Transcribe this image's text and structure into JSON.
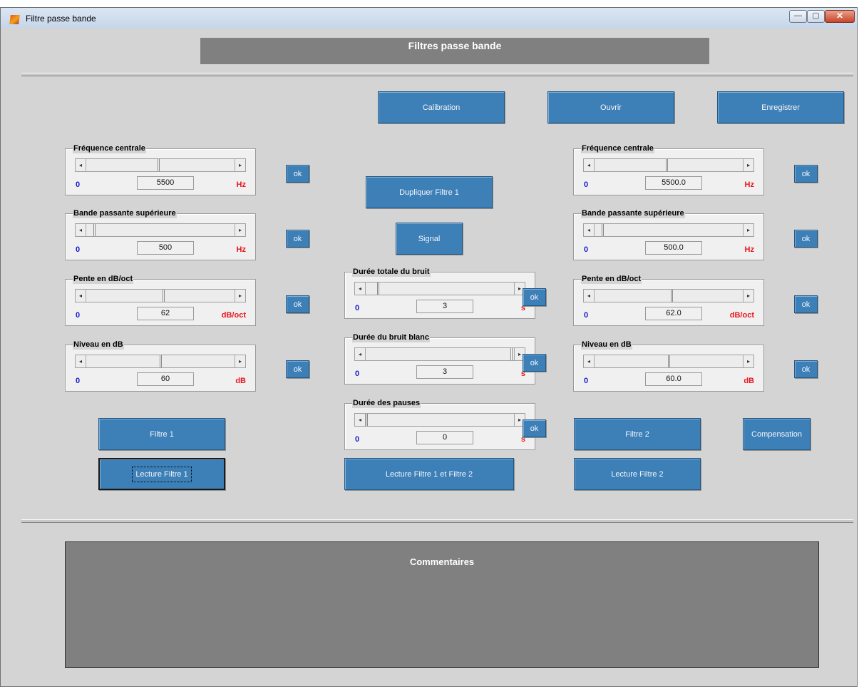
{
  "window": {
    "title": "Filtre passe bande",
    "min_symbol": "—",
    "max_symbol": "▢",
    "close_symbol": "✕"
  },
  "header": {
    "title": "Filtres passe bande"
  },
  "toolbar": {
    "calibration": "Calibration",
    "open": "Ouvrir",
    "save": "Enregistrer"
  },
  "filter1": {
    "freq": {
      "title": "Fréquence centrale",
      "min": "0",
      "value": "5500",
      "unit": "Hz",
      "level": 0.49
    },
    "bande": {
      "title": "Bande passante supérieure",
      "min": "0",
      "value": "500",
      "unit": "Hz",
      "level": 0.05
    },
    "pente": {
      "title": "Pente en dB/oct",
      "min": "0",
      "value": "62",
      "unit": "dB/oct",
      "level": 0.52
    },
    "niveau": {
      "title": "Niveau en dB",
      "min": "0",
      "value": "60",
      "unit": "dB",
      "level": 0.5
    },
    "ok": "ok",
    "button": "Filtre 1",
    "play": "Lecture Filtre 1"
  },
  "filter2": {
    "freq": {
      "title": "Fréquence centrale",
      "min": "0",
      "value": "5500.0",
      "unit": "Hz",
      "level": 0.49
    },
    "bande": {
      "title": "Bande passante supérieure",
      "min": "0",
      "value": "500.0",
      "unit": "Hz",
      "level": 0.05
    },
    "pente": {
      "title": "Pente en dB/oct",
      "min": "0",
      "value": "62.0",
      "unit": "dB/oct",
      "level": 0.52
    },
    "niveau": {
      "title": "Niveau en dB",
      "min": "0",
      "value": "60.0",
      "unit": "dB",
      "level": 0.5
    },
    "ok": "ok",
    "button": "Filtre 2",
    "play": "Lecture Filtre 2"
  },
  "center": {
    "duplicate": "Dupliquer  Filtre 1",
    "signal": "Signal",
    "duree_totale": {
      "title": "Durée totale du bruit",
      "min": "0",
      "value": "3",
      "unit": "s",
      "level": 0.08
    },
    "duree_blanc": {
      "title": "Durée du bruit blanc",
      "min": "0",
      "value": "3",
      "unit": "s",
      "level": 0.99
    },
    "duree_pauses": {
      "title": "Durée des pauses",
      "min": "0",
      "value": "0",
      "unit": "s",
      "level": 0.0
    },
    "ok": "ok",
    "play_both": "Lecture  Filtre 1 et Filtre 2"
  },
  "compensation": "Compensation",
  "comments": {
    "title": "Commentaires"
  },
  "arrows": {
    "left": "◂",
    "right": "▸"
  }
}
